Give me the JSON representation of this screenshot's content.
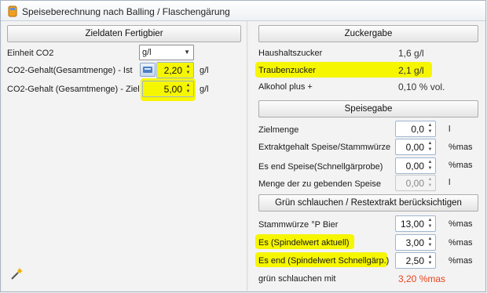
{
  "window": {
    "title": "Speiseberechnung nach Balling / Flaschengärung"
  },
  "left": {
    "header": "Zieldaten Fertigbier",
    "unit_label": "Einheit CO2",
    "unit_value": "g/l",
    "co2_ist_label": "CO2-Gehalt(Gesamtmenge) - Ist",
    "co2_ist_value": "2,20",
    "co2_ist_unit": "g/l",
    "co2_ziel_label": "CO2-Gehalt (Gesamtmenge) - Ziel",
    "co2_ziel_value": "5,00",
    "co2_ziel_unit": "g/l"
  },
  "sugar": {
    "header": "Zuckergabe",
    "household_label": "Haushaltszucker",
    "household_value": "1,6 g/l",
    "grape_label": "Traubenzucker",
    "grape_value": "2,1 g/l",
    "alcohol_label": "Alkohol plus +",
    "alcohol_value": "0,10 % vol."
  },
  "speise": {
    "header": "Speisegabe",
    "zielmenge_label": "Zielmenge",
    "zielmenge_value": "0,0",
    "zielmenge_unit": "l",
    "extrakt_label": "Extraktgehalt Speise/Stammwürze",
    "extrakt_value": "0,00",
    "extrakt_unit": "%mas",
    "es_end_label": "Es end Speise(Schnellgärprobe)",
    "es_end_value": "0,00",
    "es_end_unit": "%mas",
    "menge_label": "Menge der zu gebenden Speise",
    "menge_value": "0,00",
    "menge_unit": "l"
  },
  "gruen": {
    "header": "Grün schlauchen / Restextrakt berücksichtigen",
    "stamm_label": "Stammwürze °P Bier",
    "stamm_value": "13,00",
    "stamm_unit": "%mas",
    "es_akt_label": "Es (Spindelwert aktuell)",
    "es_akt_value": "3,00",
    "es_akt_unit": "%mas",
    "es_end_label": "Es end (Spindelwert Schnellgärp.)",
    "es_end_value": "2,50",
    "es_end_unit": "%mas",
    "result_label": "grün schlauchen mit",
    "result_value": "3,20 %mas"
  },
  "colors": {
    "highlight": "#f6f600",
    "result": "#e8431c"
  },
  "icons": [
    "window-icon",
    "calc-icon",
    "wand-icon",
    "spin-arrows-icon",
    "dropdown-arrow-icon"
  ]
}
